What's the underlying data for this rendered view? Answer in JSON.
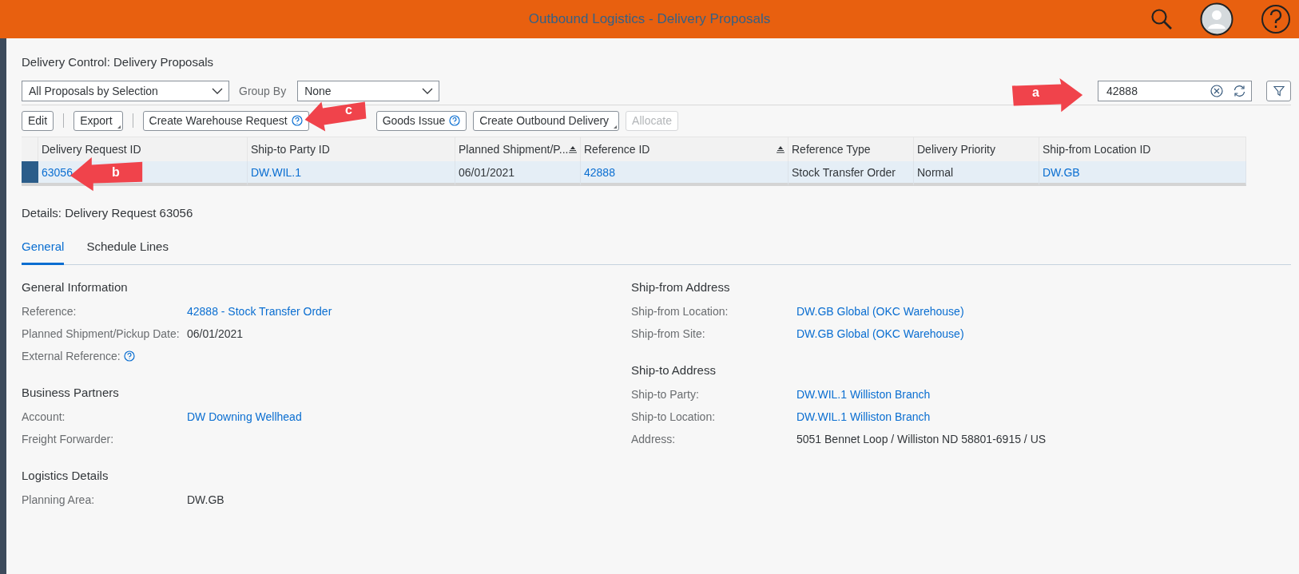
{
  "header": {
    "title": "Outbound Logistics - Delivery Proposals"
  },
  "page_title": "Delivery Control: Delivery Proposals",
  "variant_select": {
    "value": "All Proposals by Selection"
  },
  "group_by": {
    "label": "Group By",
    "value": "None"
  },
  "search": {
    "value": "42888"
  },
  "toolbar": [
    {
      "kind": "button",
      "label": "Edit",
      "menu": false,
      "help": false,
      "disabled": false
    },
    {
      "kind": "separator"
    },
    {
      "kind": "button",
      "label": "Export",
      "menu": true,
      "help": false,
      "disabled": false
    },
    {
      "kind": "separator"
    },
    {
      "kind": "button",
      "label": "Create Warehouse Request",
      "menu": false,
      "help": true,
      "disabled": false
    },
    {
      "kind": "button",
      "label": "Goods Issue",
      "menu": false,
      "help": true,
      "disabled": false
    },
    {
      "kind": "button",
      "label": "Create Outbound Delivery",
      "menu": true,
      "help": false,
      "disabled": false
    },
    {
      "kind": "button",
      "label": "Allocate",
      "menu": false,
      "help": false,
      "disabled": true
    }
  ],
  "table": {
    "columns": [
      {
        "label": "Delivery Request ID",
        "sorted": false
      },
      {
        "label": "Ship-to Party ID",
        "sorted": false
      },
      {
        "label": "Planned Shipment/P...",
        "sorted": true
      },
      {
        "label": "Reference ID",
        "sorted": true
      },
      {
        "label": "Reference Type",
        "sorted": false
      },
      {
        "label": "Delivery Priority",
        "sorted": false
      },
      {
        "label": "Ship-from Location ID",
        "sorted": false
      }
    ],
    "rows": [
      {
        "selected": true,
        "cells": [
          {
            "text": "63056",
            "link": true
          },
          {
            "text": "DW.WIL.1",
            "link": true
          },
          {
            "text": "06/01/2021",
            "link": false
          },
          {
            "text": "42888",
            "link": true
          },
          {
            "text": "Stock Transfer Order",
            "link": false
          },
          {
            "text": "Normal",
            "link": false
          },
          {
            "text": "DW.GB",
            "link": true
          }
        ]
      }
    ]
  },
  "details": {
    "title": "Details: Delivery Request 63056",
    "tabs": [
      {
        "label": "General",
        "selected": true
      },
      {
        "label": "Schedule Lines",
        "selected": false
      }
    ],
    "columns": [
      [
        {
          "title": "General Information",
          "fields": [
            {
              "label": "Reference:",
              "value": "42888 - Stock Transfer Order",
              "link": true,
              "help": false
            },
            {
              "label": "Planned Shipment/Pickup Date:",
              "value": "06/01/2021",
              "link": false,
              "help": false
            },
            {
              "label": "External Reference:",
              "help": true
            }
          ]
        },
        {
          "title": "Business Partners",
          "fields": [
            {
              "label": "Account:",
              "value": "DW Downing Wellhead",
              "link": true,
              "help": false
            },
            {
              "label": "Freight Forwarder:",
              "help": false
            }
          ]
        },
        {
          "title": "Logistics Details",
          "fields": [
            {
              "label": "Planning Area:",
              "value": "DW.GB",
              "link": false,
              "help": false
            }
          ]
        }
      ],
      [
        {
          "title": "Ship-from Address",
          "fields": [
            {
              "label": "Ship-from Location:",
              "value": "DW.GB Global (OKC Warehouse)",
              "link": true,
              "help": false
            },
            {
              "label": "Ship-from Site:",
              "value": "DW.GB Global (OKC Warehouse)",
              "link": true,
              "help": false
            }
          ]
        },
        {
          "title": "Ship-to Address",
          "fields": [
            {
              "label": "Ship-to Party:",
              "value": "DW.WIL.1 Williston Branch",
              "link": true,
              "help": false
            },
            {
              "label": "Ship-to Location:",
              "value": "DW.WIL.1 Williston Branch",
              "link": true,
              "help": false
            },
            {
              "label": "Address:",
              "value": "5051 Bennet Loop / Williston ND 58801-6915 / US",
              "link": false,
              "help": false
            }
          ]
        }
      ]
    ]
  },
  "callouts": [
    {
      "label": "a"
    },
    {
      "label": "b"
    },
    {
      "label": "c"
    }
  ]
}
